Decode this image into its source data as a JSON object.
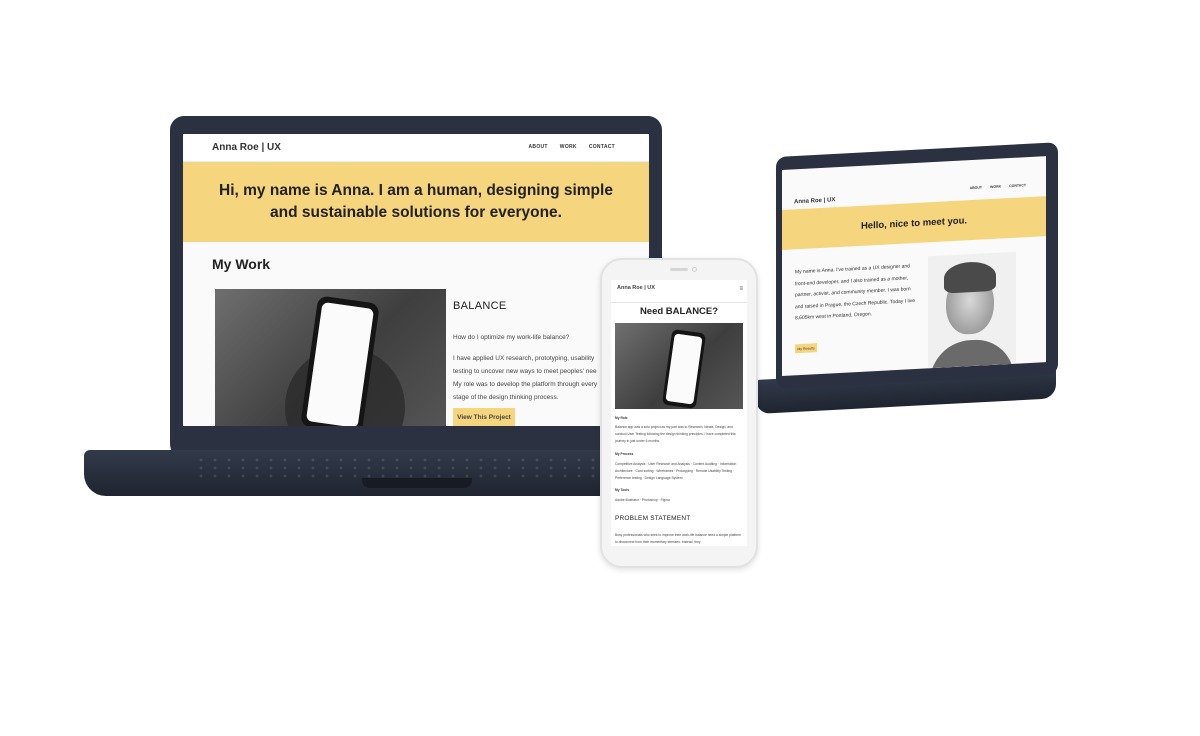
{
  "laptop": {
    "brand": "Anna Roe | UX",
    "nav": [
      "ABOUT",
      "WORK",
      "CONTACT"
    ],
    "hero": "Hi, my name is Anna. I am a human, designing simple and sustainable solutions for everyone.",
    "section_title": "My Work",
    "project": {
      "title": "BALANCE",
      "question": "How do I optimize my work-life balance?",
      "description": "I have applied UX research, prototyping, usability\ntesting to uncover new ways to meet peoples' nee\nMy role was to develop the platform through every\nstage of the design thinking process.",
      "button": "View This Project"
    }
  },
  "small_laptop": {
    "brand": "Anna Roe | UX",
    "nav": [
      "ABOUT",
      "WORK",
      "CONTACT"
    ],
    "hero": "Hello, nice to meet you.",
    "bio": "My name is Anna. I've trained as a UX designer and front-end developer, and I also trained as a mother, partner, activist, and community member. I was born and raised in Prague, the Czech Republic. Today I live 8,605km west in Portland, Oregon.",
    "button": "My Results"
  },
  "phone": {
    "brand": "Anna Roe | UX",
    "menu_icon": "≡",
    "title": "Need BALANCE?",
    "role_head": "My Role",
    "role_text": "Balance app was a solo project as my part was to Research, Ideate, Design, and conduct User Testing following the design thinking principles. I have completed this journey in just under 6 months.",
    "process_head": "My Process",
    "process_text": "Competitive Analysis · User Research and Analysis · Content Auditing · Information Architecture · Card sorting · Wireframes · Prototyping · Remote Usability Testing · Preference testing · Design Language System",
    "tools_head": "My Tools",
    "tools_text": "Adobe Illustrator · Photoshop · Figma",
    "problem_title": "PROBLEM STATEMENT",
    "problem_text": "Busy professionals who seek to improve their work-life balance need a simple platform to disconnect from their momentary stresses. Instead, they"
  },
  "colors": {
    "accent": "#f6d57f",
    "device": "#2b3140"
  }
}
